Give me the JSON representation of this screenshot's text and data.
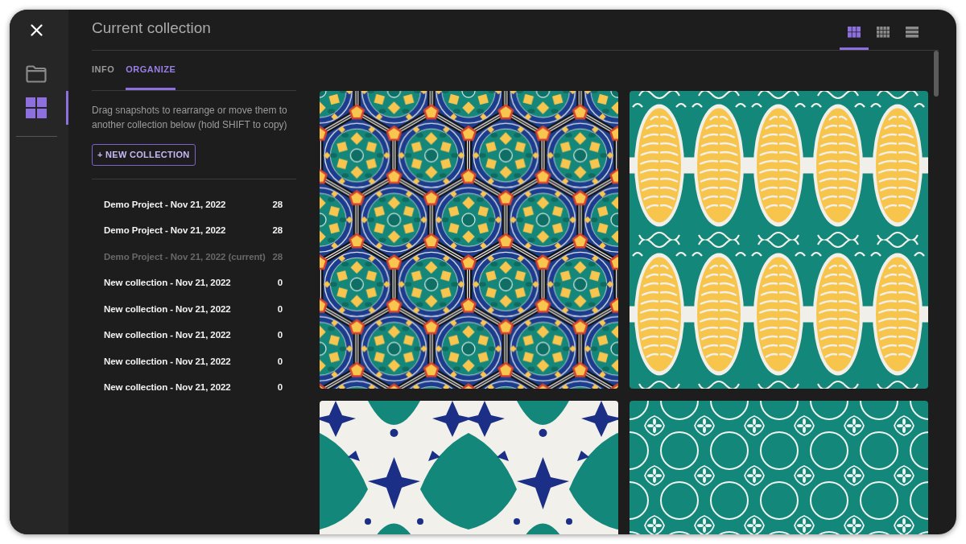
{
  "window": {
    "title": "Current collection"
  },
  "rail_items": [
    {
      "kind": "folder",
      "selected": false
    },
    {
      "kind": "collection",
      "selected": true
    }
  ],
  "view_modes": [
    {
      "kind": "large-grid",
      "selected": true
    },
    {
      "kind": "small-grid",
      "selected": false
    },
    {
      "kind": "list",
      "selected": false
    }
  ],
  "tabs": [
    {
      "label": "INFO",
      "selected": false
    },
    {
      "label": "ORGANIZE",
      "selected": true
    }
  ],
  "hint": "Drag snapshots to rearrange or move them to another collection below (hold SHIFT to copy)",
  "new_collection_button": "+ NEW COLLECTION",
  "collections": [
    {
      "name": "Demo Project - Nov 21, 2022",
      "count": "28",
      "disabled": false
    },
    {
      "name": "Demo Project - Nov 21, 2022",
      "count": "28",
      "disabled": false
    },
    {
      "name": "Demo Project - Nov 21, 2022 (current)",
      "count": "28",
      "disabled": true
    },
    {
      "name": "New collection - Nov 21, 2022",
      "count": "0",
      "disabled": false
    },
    {
      "name": "New collection - Nov 21, 2022",
      "count": "0",
      "disabled": false
    },
    {
      "name": "New collection - Nov 21, 2022",
      "count": "0",
      "disabled": false
    },
    {
      "name": "New collection - Nov 21, 2022",
      "count": "0",
      "disabled": false
    },
    {
      "name": "New collection - Nov 21, 2022",
      "count": "0",
      "disabled": false
    }
  ],
  "snapshots": [
    {
      "kind": "medallion"
    },
    {
      "kind": "ovals"
    },
    {
      "kind": "fans"
    },
    {
      "kind": "quatrefoil"
    }
  ]
}
